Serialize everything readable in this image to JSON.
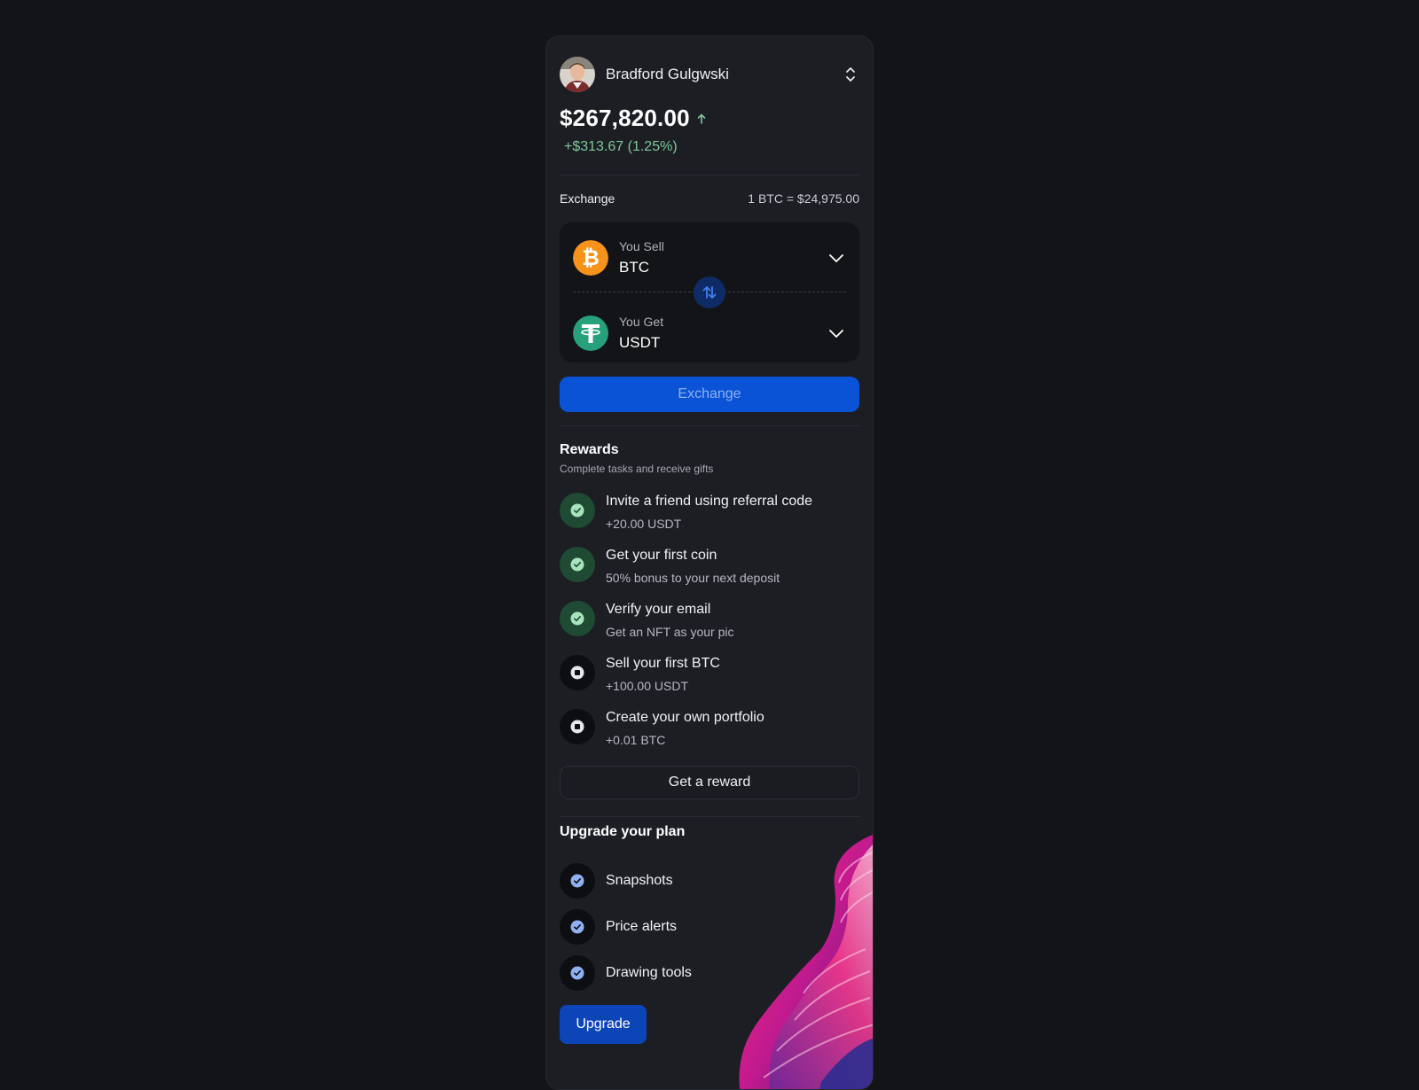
{
  "user": {
    "name": "Bradford Gulgwski"
  },
  "balance": {
    "amount": "$267,820.00",
    "change": "+$313.67 (1.25%)"
  },
  "exchange": {
    "label": "Exchange",
    "rate": "1 BTC = $24,975.00",
    "sell": {
      "label": "You Sell",
      "coin": "BTC",
      "icon": "bitcoin-icon"
    },
    "get": {
      "label": "You Get",
      "coin": "USDT",
      "icon": "tether-icon"
    },
    "button": "Exchange"
  },
  "rewards": {
    "title": "Rewards",
    "subtitle": "Complete tasks and receive gifts",
    "items": [
      {
        "title": "Invite a friend using referral code",
        "detail": "+20.00 USDT",
        "done": true
      },
      {
        "title": "Get your first coin",
        "detail": "50% bonus to your next deposit",
        "done": true
      },
      {
        "title": "Verify your email",
        "detail": "Get an NFT as your pic",
        "done": true
      },
      {
        "title": "Sell your first BTC",
        "detail": "+100.00 USDT",
        "done": false
      },
      {
        "title": "Create your own portfolio",
        "detail": "+0.01 BTC",
        "done": false
      }
    ],
    "button": "Get a reward"
  },
  "upgrade": {
    "title": "Upgrade your plan",
    "features": [
      "Snapshots",
      "Price alerts",
      "Drawing tools"
    ],
    "button": "Upgrade"
  },
  "colors": {
    "background": "#131418",
    "card": "#1c1e24",
    "accent": "#0a52d6",
    "positive": "#7fc79a",
    "bitcoin": "#f7931a",
    "tether": "#26a17b"
  }
}
